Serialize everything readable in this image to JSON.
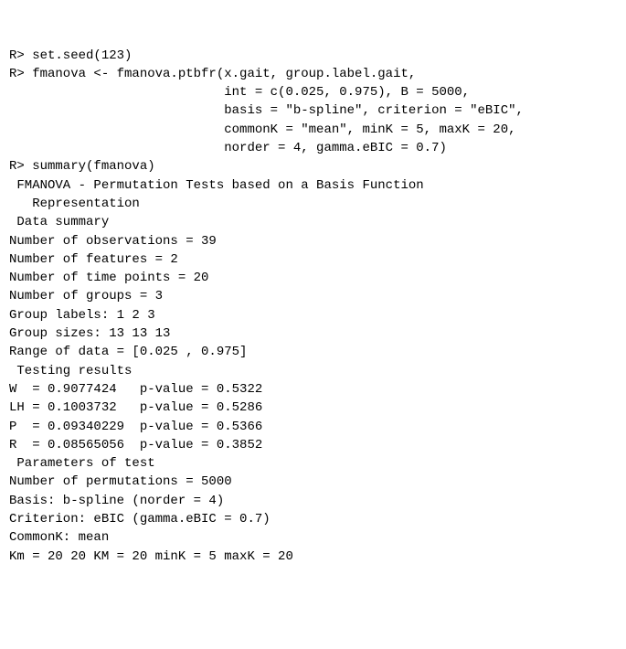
{
  "lines": {
    "l01": "R> set.seed(123)",
    "l02": "R> fmanova <- fmanova.ptbfr(x.gait, group.label.gait,",
    "l03": "                            int = c(0.025, 0.975), B = 5000,",
    "l04": "                            basis = \"b-spline\", criterion = \"eBIC\",",
    "l05": "                            commonK = \"mean\", minK = 5, maxK = 20,",
    "l06": "                            norder = 4, gamma.eBIC = 0.7)",
    "l07": "R> summary(fmanova)",
    "l08": "",
    "l09": " FMANOVA - Permutation Tests based on a Basis Function",
    "l10": "   Representation",
    "l11": "",
    "l12": " Data summary",
    "l13": "",
    "l14": "Number of observations = 39",
    "l15": "Number of features = 2",
    "l16": "Number of time points = 20",
    "l17": "Number of groups = 3",
    "l18": "Group labels: 1 2 3",
    "l19": "Group sizes: 13 13 13",
    "l20": "Range of data = [0.025 , 0.975]",
    "l21": "",
    "l22": " Testing results",
    "l23": "",
    "l24": "W  = 0.9077424   p-value = 0.5322",
    "l25": "LH = 0.1003732   p-value = 0.5286",
    "l26": "P  = 0.09340229  p-value = 0.5366",
    "l27": "R  = 0.08565056  p-value = 0.3852",
    "l28": "",
    "l29": " Parameters of test",
    "l30": "",
    "l31": "Number of permutations = 5000",
    "l32": "Basis: b-spline (norder = 4)",
    "l33": "Criterion: eBIC (gamma.eBIC = 0.7)",
    "l34": "CommonK: mean",
    "l35": "Km = 20 20 KM = 20 minK = 5 maxK = 20"
  }
}
